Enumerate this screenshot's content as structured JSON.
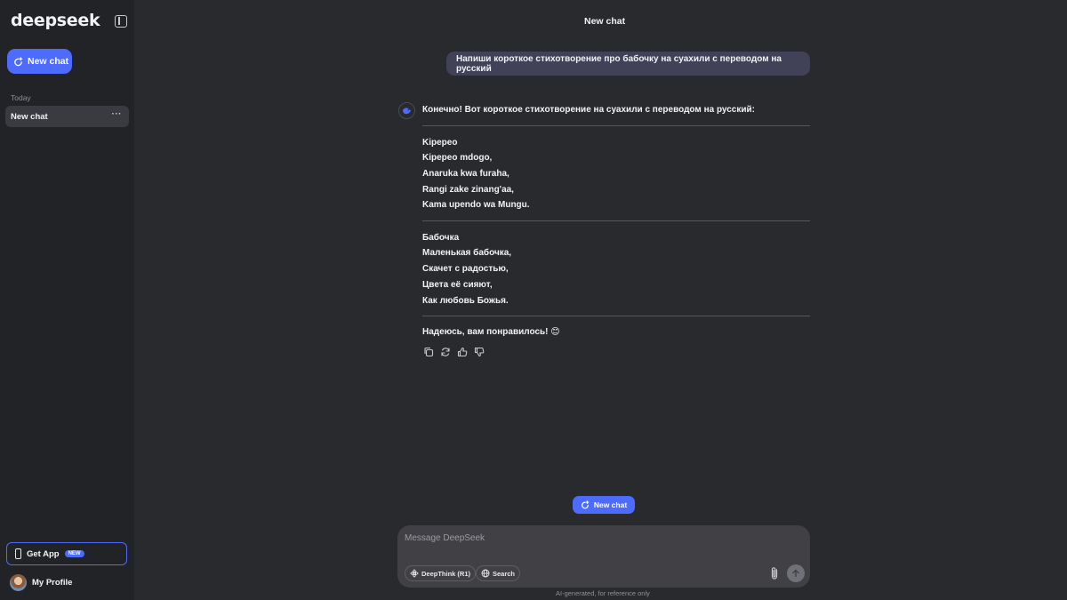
{
  "sidebar": {
    "logo": "deepseek",
    "new_chat_label": "New chat",
    "section_label": "Today",
    "chat_items": [
      {
        "label": "New chat"
      }
    ],
    "get_app_label": "Get App",
    "get_app_badge": "NEW",
    "profile_label": "My Profile"
  },
  "header": {
    "title": "New chat"
  },
  "conversation": {
    "user_message": "Напиши короткое стихотворение про бабочку на суахили с переводом на русский",
    "bot": {
      "intro": "Конечно! Вот короткое стихотворение на суахили с переводом на русский:",
      "poem_sw_title": "Kipepeo",
      "poem_sw_lines": [
        "Kipepeo mdogo,",
        "Anaruka kwa furaha,",
        "Rangi zake zinang'aa,",
        "Kama upendo wa Mungu."
      ],
      "poem_ru_title": "Бабочка",
      "poem_ru_lines": [
        "Маленькая бабочка,",
        "Скачет с радостью,",
        "Цвета её сияют,",
        "Как любовь Божья."
      ],
      "closing": "Надеюсь, вам понравилось! 😊"
    }
  },
  "floating_new_chat_label": "New chat",
  "composer": {
    "placeholder": "Message DeepSeek",
    "value": "",
    "deepthink_label": "DeepThink (R1)",
    "search_label": "Search"
  },
  "disclaimer": "AI-generated, for reference only",
  "colors": {
    "accent": "#4d6bfe",
    "sidebar_bg": "#212327",
    "main_bg": "#292a2d",
    "user_bubble": "#414158",
    "composer_bg": "#404045"
  }
}
